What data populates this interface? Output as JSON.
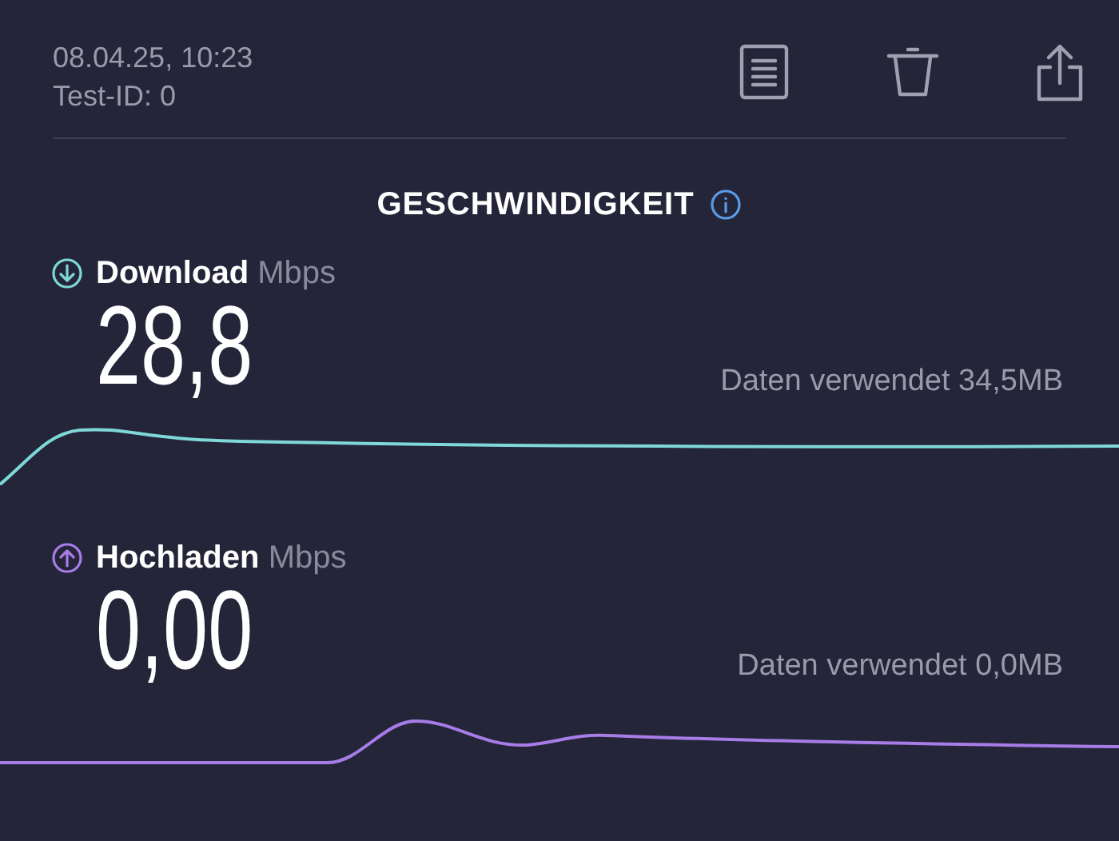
{
  "header": {
    "date": "08.04.25, 10:23",
    "test_id": "Test-ID: 0"
  },
  "section_title": "GESCHWINDIGKEIT",
  "measurements": [
    {
      "kind": "download",
      "label": "Download",
      "unit": "Mbps",
      "value": "28,8",
      "data_used": "Daten verwendet 34,5MB",
      "color": "#7fd8d8"
    },
    {
      "kind": "upload",
      "label": "Hochladen",
      "unit": "Mbps",
      "value": "0,00",
      "data_used": "Daten verwendet 0,0MB",
      "color": "#a77ce6"
    }
  ]
}
